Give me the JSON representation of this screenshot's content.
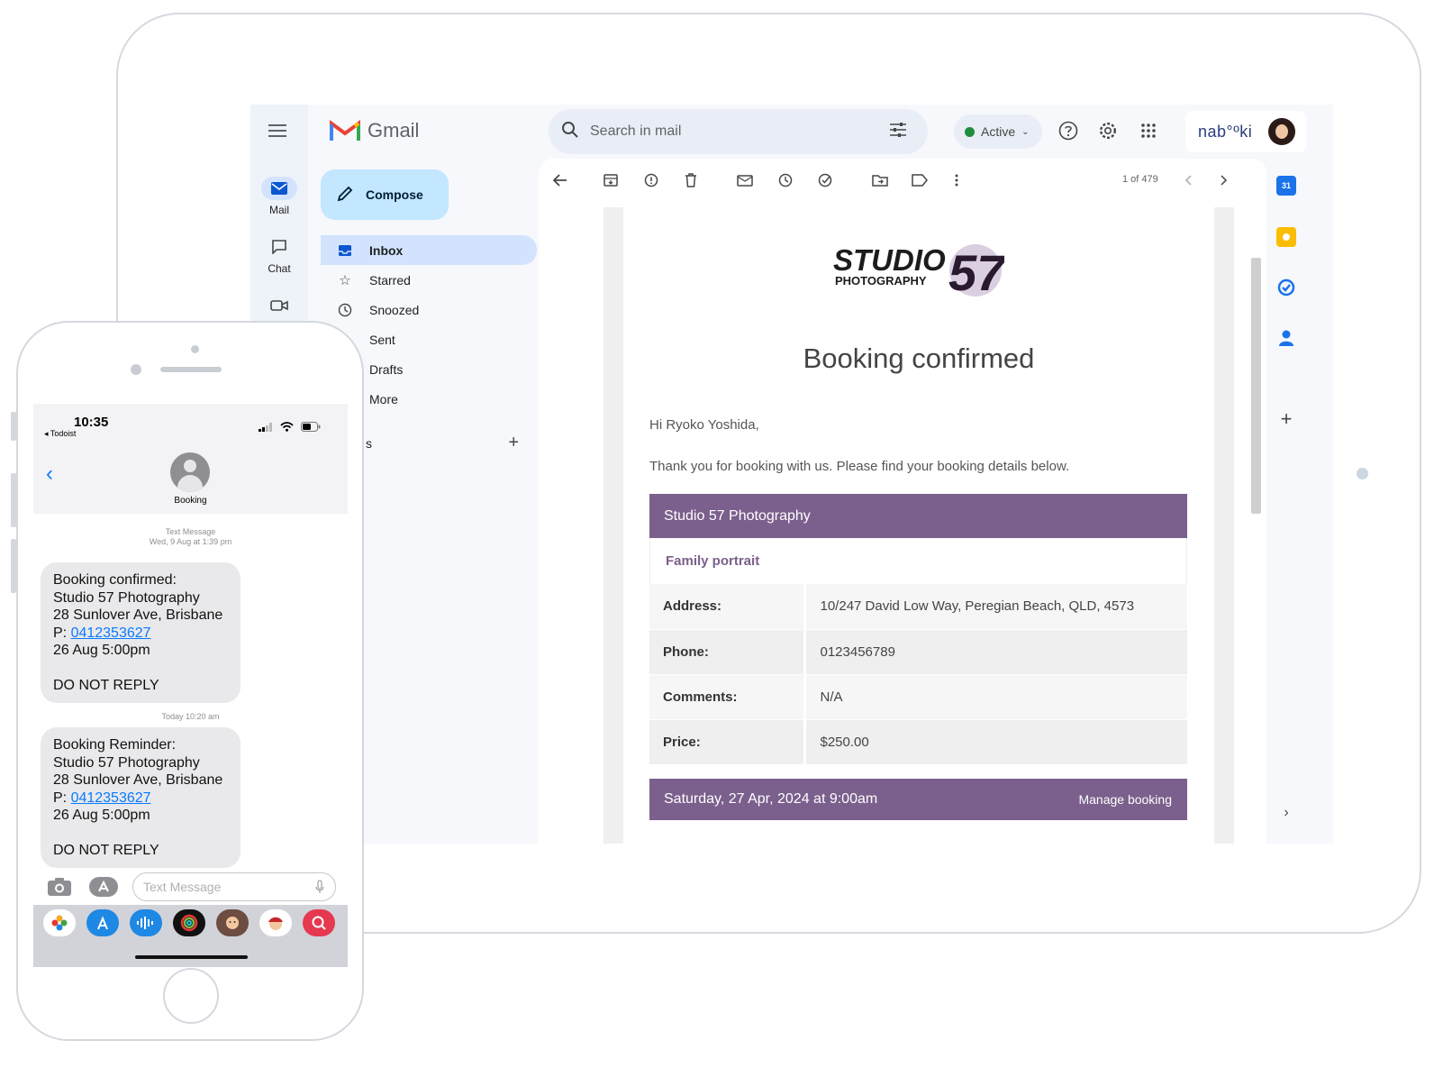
{
  "gmail": {
    "app_name": "Gmail",
    "rail": {
      "mail_label": "Mail",
      "chat_label": "Chat"
    },
    "compose_label": "Compose",
    "nav": [
      {
        "label": "Inbox",
        "icon": "inbox-icon"
      },
      {
        "label": "Starred",
        "icon": "star-icon"
      },
      {
        "label": "Snoozed",
        "icon": "clock-icon"
      },
      {
        "label": "Sent",
        "icon": "send-icon"
      },
      {
        "label": "Drafts",
        "icon": "draft-icon"
      },
      {
        "label": "More",
        "icon": "chevron-down-icon"
      }
    ],
    "labels_header": "s",
    "search_placeholder": "Search in mail",
    "status_label": "Active",
    "account_brand": "nab°ºki",
    "pager": "1 of 479"
  },
  "email": {
    "brand_top": "STUDIO",
    "brand_num": "57",
    "brand_sub": "PHOTOGRAPHY",
    "headline": "Booking confirmed",
    "greeting": "Hi Ryoko Yoshida,",
    "intro": "Thank you for booking with us. Please find your booking details below.",
    "business": "Studio 57 Photography",
    "service": "Family portrait",
    "details": [
      {
        "label": "Address:",
        "value": "10/247 David Low Way, Peregian Beach, QLD, 4573"
      },
      {
        "label": "Phone:",
        "value": "0123456789"
      },
      {
        "label": "Comments:",
        "value": "N/A"
      },
      {
        "label": "Price:",
        "value": "$250.00"
      }
    ],
    "datetime": "Saturday, 27 Apr, 2024 at 9:00am",
    "manage_label": "Manage booking"
  },
  "phone": {
    "time": "10:35",
    "back_app": "◂ Todoist",
    "contact": "Booking",
    "meta1_type": "Text Message",
    "meta1_date": "Wed, 9 Aug at 1:39 pm",
    "msg1": {
      "line1": "Booking confirmed:",
      "line2": "Studio 57 Photography",
      "line3": "28 Sunlover Ave, Brisbane",
      "phone_prefix": "P: ",
      "phone": "0412353627",
      "line5": "26 Aug 5:00pm",
      "line6": "DO NOT REPLY"
    },
    "meta2_date": "Today 10:20 am",
    "msg2": {
      "line1": "Booking Reminder:",
      "line2": "Studio 57 Photography",
      "line3": "28 Sunlover Ave, Brisbane",
      "phone_prefix": "P: ",
      "phone": "0412353627",
      "line5": "26 Aug 5:00pm",
      "line6": "DO NOT REPLY"
    },
    "input_placeholder": "Text Message"
  },
  "colors": {
    "brand_purple": "#7b5f8c",
    "gmail_active": "#d3e3fd",
    "compose": "#c2e7ff",
    "link_blue": "#0a7aff"
  }
}
